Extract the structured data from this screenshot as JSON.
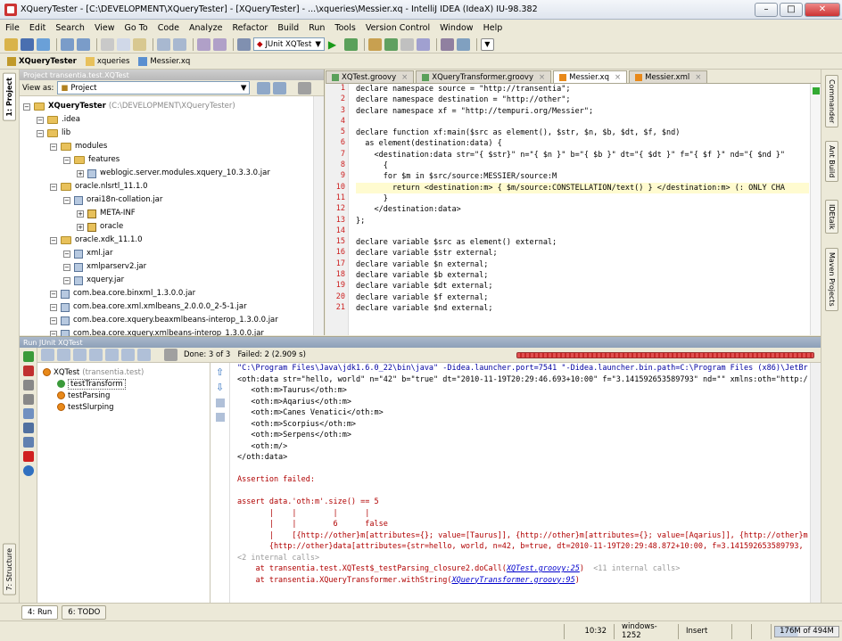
{
  "window": {
    "title": "XQueryTester - [C:\\DEVELOPMENT\\XQueryTester] - [XQueryTester] - ...\\xqueries\\Messier.xq - IntelliJ IDEA (IdeaX) IU-98.382"
  },
  "menu": [
    "File",
    "Edit",
    "Search",
    "View",
    "Go To",
    "Code",
    "Analyze",
    "Refactor",
    "Build",
    "Run",
    "Tools",
    "Version Control",
    "Window",
    "Help"
  ],
  "toolbar": {
    "run_config": "JUnit XQTest"
  },
  "breadcrumbs": [
    "XQueryTester",
    "xqueries",
    "Messier.xq"
  ],
  "project": {
    "header": "Project  transentia.test.XQTest",
    "view_as_label": "View as:",
    "view_as_value": "Project",
    "tree": [
      {
        "label": "XQueryTester",
        "suffix": "(C:\\DEVELOPMENT\\XQueryTester)",
        "kind": "folder",
        "depth": 0,
        "bold": true
      },
      {
        "label": ".idea",
        "kind": "folder",
        "depth": 1
      },
      {
        "label": "lib",
        "kind": "folder",
        "depth": 1
      },
      {
        "label": "modules",
        "kind": "folder",
        "depth": 2
      },
      {
        "label": "features",
        "kind": "folder",
        "depth": 3
      },
      {
        "label": "weblogic.server.modules.xquery_10.3.3.0.jar",
        "kind": "jar",
        "depth": 4
      },
      {
        "label": "oracle.nlsrtl_11.1.0",
        "kind": "folder",
        "depth": 2
      },
      {
        "label": "orai18n-collation.jar",
        "kind": "jar",
        "depth": 3
      },
      {
        "label": "META-INF",
        "kind": "pkg",
        "depth": 4
      },
      {
        "label": "oracle",
        "kind": "pkg",
        "depth": 4
      },
      {
        "label": "oracle.xdk_11.1.0",
        "kind": "folder",
        "depth": 2
      },
      {
        "label": "xml.jar",
        "kind": "jar",
        "depth": 3
      },
      {
        "label": "xmlparserv2.jar",
        "kind": "jar",
        "depth": 3
      },
      {
        "label": "xquery.jar",
        "kind": "jar",
        "depth": 3
      },
      {
        "label": "com.bea.core.binxml_1.3.0.0.jar",
        "kind": "jar",
        "depth": 2
      },
      {
        "label": "com.bea.core.xml.xmlbeans_2.0.0.0_2-5-1.jar",
        "kind": "jar",
        "depth": 2
      },
      {
        "label": "com.bea.core.xquery.beaxmlbeans-interop_1.3.0.0.jar",
        "kind": "jar",
        "depth": 2
      },
      {
        "label": "com.bea.core.xquery.xmlbeans-interop_1.3.0.0.jar",
        "kind": "jar",
        "depth": 2
      }
    ]
  },
  "editor": {
    "tabs": [
      {
        "label": "XQTest.groovy",
        "active": false
      },
      {
        "label": "XQueryTransformer.groovy",
        "active": false
      },
      {
        "label": "Messier.xq",
        "active": true
      },
      {
        "label": "Messier.xml",
        "active": false
      }
    ],
    "lines": [
      "declare namespace source = \"http://transentia\";",
      "declare namespace destination = \"http://other\";",
      "declare namespace xf = \"http://tempuri.org/Messier\";",
      "",
      "declare function xf:main($src as element(), $str, $n, $b, $dt, $f, $nd)",
      "  as element(destination:data) {",
      "    <destination:data str=\"{ $str}\" n=\"{ $n }\" b=\"{ $b }\" dt=\"{ $dt }\" f=\"{ $f }\" nd=\"{ $nd }\"",
      "      {",
      "      for $m in $src/source:MESSIER/source:M",
      "        return <destination:m> { $m/source:CONSTELLATION/text() } </destination:m> (: ONLY CHA",
      "      }",
      "    </destination:data>",
      "};",
      "",
      "declare variable $src as element() external;",
      "declare variable $str external;",
      "declare variable $n external;",
      "declare variable $b external;",
      "declare variable $dt external;",
      "declare variable $f external;",
      "declare variable $nd external;"
    ],
    "current_line": 10
  },
  "run": {
    "header": "Run  JUnit XQTest",
    "status": "Done: 3 of 3   Failed: 2 (2.909 s)",
    "tests": [
      {
        "label": "XQTest",
        "suffix": "(transentia.test)",
        "status": "err",
        "depth": 0
      },
      {
        "label": "testTransform",
        "status": "ok",
        "depth": 1,
        "selected": true
      },
      {
        "label": "testParsing",
        "status": "err",
        "depth": 1
      },
      {
        "label": "testSlurping",
        "status": "err",
        "depth": 1
      }
    ],
    "console": [
      {
        "t": "\"C:\\Program Files\\Java\\jdk1.6.0_22\\bin\\java\" -Didea.launcher.port=7541 \"-Didea.launcher.bin.path=C:\\Program Files (x86)\\JetBr",
        "c": "c-blue"
      },
      {
        "t": "<oth:data str=\"hello, world\" n=\"42\" b=\"true\" dt=\"2010-11-19T20:29:46.693+10:00\" f=\"3.141592653589793\" nd=\"\" xmlns:oth=\"http:/",
        "c": ""
      },
      {
        "t": "   <oth:m>Taurus</oth:m>",
        "c": ""
      },
      {
        "t": "   <oth:m>Aqarius</oth:m>",
        "c": ""
      },
      {
        "t": "   <oth:m>Canes Venatici</oth:m>",
        "c": ""
      },
      {
        "t": "   <oth:m>Scorpius</oth:m>",
        "c": ""
      },
      {
        "t": "   <oth:m>Serpens</oth:m>",
        "c": ""
      },
      {
        "t": "   <oth:m/>",
        "c": ""
      },
      {
        "t": "</oth:data>",
        "c": ""
      },
      {
        "t": "",
        "c": ""
      },
      {
        "t": "Assertion failed:",
        "c": "c-red"
      },
      {
        "t": "",
        "c": ""
      },
      {
        "t": "assert data.'oth:m'.size() == 5",
        "c": "c-red"
      },
      {
        "t": "       |    |        |      |",
        "c": "c-red"
      },
      {
        "t": "       |    |        6      false",
        "c": "c-red"
      },
      {
        "t": "       |    [{http://other}m[attributes={}; value=[Taurus]], {http://other}m[attributes={}; value=[Aqarius]], {http://other}m",
        "c": "c-red"
      },
      {
        "t": "       {http://other}data[attributes={str=hello, world, n=42, b=true, dt=2010-11-19T20:29:48.872+10:00, f=3.141592653589793,",
        "c": "c-red"
      },
      {
        "t": "<2 internal calls>",
        "c": "c-grey"
      },
      {
        "t": "    at transentia.test.XQTest$_testParsing_closure2.doCall(|XQTest.groovy:25|)  <11 internal calls>",
        "c": "c-red"
      },
      {
        "t": "    at transentia.XQueryTransformer.withString(|XQueryTransformer.groovy:95|)",
        "c": "c-red"
      }
    ]
  },
  "left_tabs": [
    "1: Project",
    "7: Structure"
  ],
  "right_tabs": [
    "Commander",
    "Ant Build",
    "IDEtalk",
    "Maven Projects"
  ],
  "bottom_tabs": [
    {
      "label": "4: Run",
      "active": true
    },
    {
      "label": "6: TODO",
      "active": false
    }
  ],
  "status": {
    "position": "10:32",
    "encoding": "windows-1252",
    "mode": "Insert",
    "memory": "176M of 494M"
  }
}
